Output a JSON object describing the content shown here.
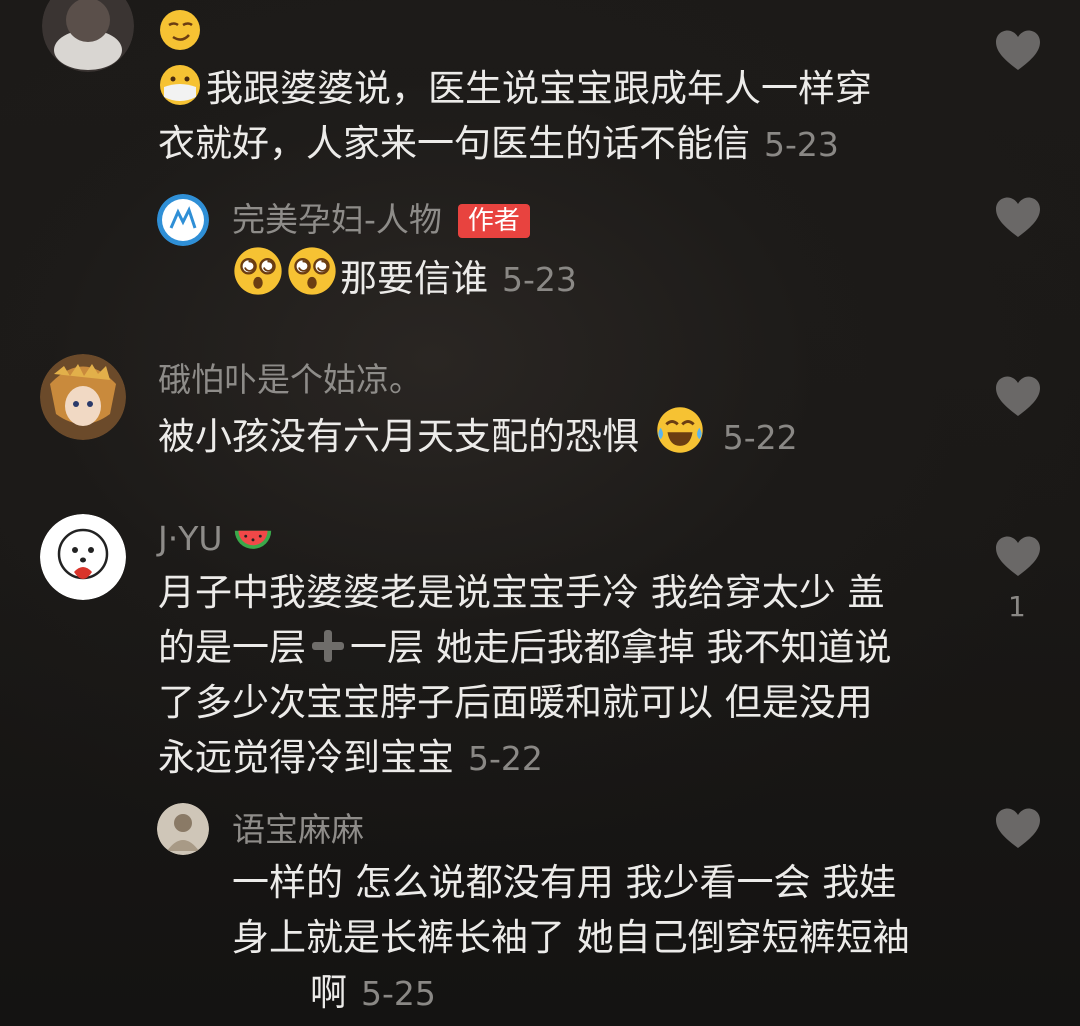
{
  "comments": [
    {
      "id": "c1",
      "username": "",
      "emoji_top": "smirk-emoji",
      "lead_emoji": "mask-emoji",
      "text_lines": [
        "我跟婆婆说，医生说宝宝跟成年人一样穿",
        "衣就好，人家来一句医生的话不能信"
      ],
      "time": "5-23"
    },
    {
      "id": "r1",
      "username": "完美孕妇-人物",
      "badge": "作者",
      "lead_emojis": [
        "dizzy-face-emoji",
        "dizzy-face-emoji"
      ],
      "text": "那要信谁",
      "time": "5-23"
    },
    {
      "id": "c2",
      "username": "硪怕卟是个姑凉。",
      "text": "被小孩没有六月天支配的恐惧",
      "trail_emoji": "tears-of-joy-emoji",
      "time": "5-22"
    },
    {
      "id": "c3",
      "username": "J·YU",
      "username_emoji": "watermelon-emoji",
      "text_lines": [
        "月子中我婆婆老是说宝宝手冷 我给穿太少 盖",
        "的是一层",
        "一层 她走后我都拿掉 我不知道说",
        "了多少次宝宝脖子后面暖和就可以 但是没用",
        "永远觉得冷到宝宝"
      ],
      "inline_icon": "plus-icon",
      "time": "5-22",
      "likes": "1"
    },
    {
      "id": "r2",
      "username": "语宝麻麻",
      "text_lines": [
        "一样的 怎么说都没有用 我少看一会 我娃",
        "身上就是长裤长袖了 她自己倒穿短裤短袖",
        "啊"
      ],
      "time": "5-25"
    }
  ],
  "icons": {
    "like": "heart-icon"
  },
  "colors": {
    "background": "#1a1816",
    "text": "#ecebe9",
    "muted": "#8e8c89",
    "badge": "#e8433f",
    "heart": "#6a6867"
  }
}
